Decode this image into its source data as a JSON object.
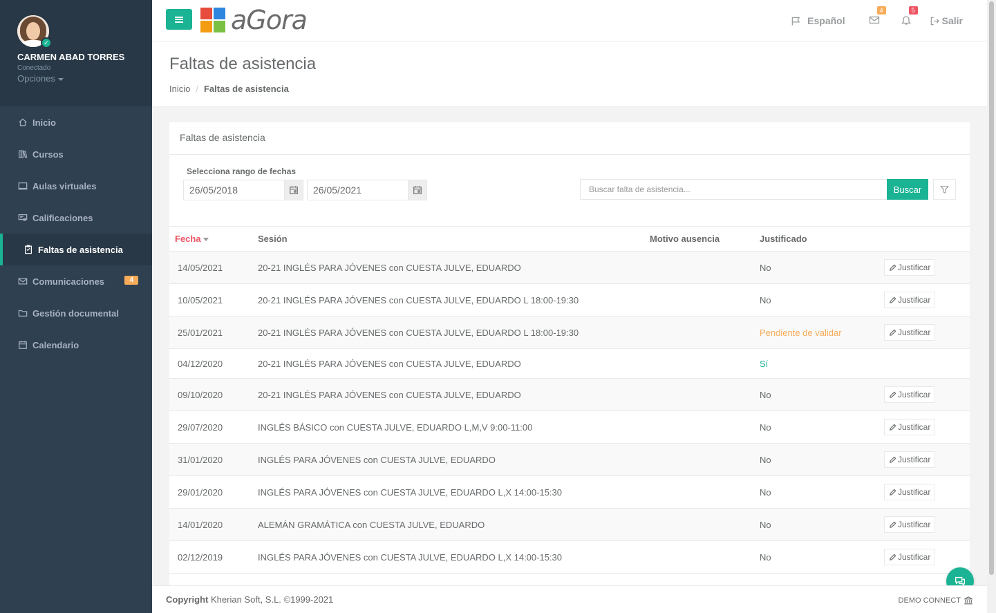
{
  "user": {
    "name": "CARMEN ABAD TORRES",
    "status": "Conectado",
    "options_label": "Opciones"
  },
  "sidebar": {
    "items": [
      {
        "label": "Inicio",
        "icon": "home-icon"
      },
      {
        "label": "Cursos",
        "icon": "books-icon"
      },
      {
        "label": "Aulas virtuales",
        "icon": "monitor-icon"
      },
      {
        "label": "Calificaciones",
        "icon": "certificate-icon"
      },
      {
        "label": "Faltas de asistencia",
        "icon": "clipboard-icon",
        "active": true
      },
      {
        "label": "Comunicaciones",
        "icon": "envelope-icon",
        "badge": "4"
      },
      {
        "label": "Gestión documental",
        "icon": "folder-icon"
      },
      {
        "label": "Calendario",
        "icon": "calendar-icon"
      }
    ]
  },
  "topbar": {
    "logo_text": "aGora",
    "language": "Español",
    "mail_badge": "4",
    "notif_badge": "5",
    "logout": "Salir"
  },
  "page": {
    "title": "Faltas de asistencia",
    "breadcrumb_home": "Inicio",
    "breadcrumb_current": "Faltas de asistencia"
  },
  "panel": {
    "title": "Faltas de asistencia",
    "range_label": "Selecciona rango de fechas",
    "date_from": "26/05/2018",
    "date_to": "26/05/2021",
    "search_placeholder": "Buscar falta de asistencia...",
    "search_button": "Buscar"
  },
  "table": {
    "headers": {
      "fecha": "Fecha",
      "sesion": "Sesión",
      "motivo": "Motivo ausencia",
      "justificado": "Justificado"
    },
    "action_label": "Justificar",
    "rows": [
      {
        "fecha": "14/05/2021",
        "sesion": "20-21 INGLÉS PARA JÓVENES con CUESTA JULVE, EDUARDO",
        "motivo": "",
        "justificado": "No",
        "status": "no",
        "action": true
      },
      {
        "fecha": "10/05/2021",
        "sesion": "20-21 INGLÉS PARA JÓVENES con CUESTA JULVE, EDUARDO L 18:00-19:30",
        "motivo": "",
        "justificado": "No",
        "status": "no",
        "action": true
      },
      {
        "fecha": "25/01/2021",
        "sesion": "20-21 INGLÉS PARA JÓVENES con CUESTA JULVE, EDUARDO L 18:00-19:30",
        "motivo": "",
        "justificado": "Pendiente de validar",
        "status": "pending",
        "action": true
      },
      {
        "fecha": "04/12/2020",
        "sesion": "20-21 INGLÉS PARA JÓVENES con CUESTA JULVE, EDUARDO",
        "motivo": "",
        "justificado": "Sí",
        "status": "yes",
        "action": false
      },
      {
        "fecha": "09/10/2020",
        "sesion": "20-21 INGLÉS PARA JÓVENES con CUESTA JULVE, EDUARDO",
        "motivo": "",
        "justificado": "No",
        "status": "no",
        "action": true
      },
      {
        "fecha": "29/07/2020",
        "sesion": "INGLÉS BÁSICO con CUESTA JULVE, EDUARDO L,M,V 9:00-11:00",
        "motivo": "",
        "justificado": "No",
        "status": "no",
        "action": true
      },
      {
        "fecha": "31/01/2020",
        "sesion": "INGLÉS PARA JÓVENES con CUESTA JULVE, EDUARDO",
        "motivo": "",
        "justificado": "No",
        "status": "no",
        "action": true
      },
      {
        "fecha": "29/01/2020",
        "sesion": "INGLÉS PARA JÓVENES con CUESTA JULVE, EDUARDO L,X 14:00-15:30",
        "motivo": "",
        "justificado": "No",
        "status": "no",
        "action": true
      },
      {
        "fecha": "14/01/2020",
        "sesion": "ALEMÁN GRAMÁTICA con CUESTA JULVE, EDUARDO",
        "motivo": "",
        "justificado": "No",
        "status": "no",
        "action": true
      },
      {
        "fecha": "02/12/2019",
        "sesion": "INGLÉS PARA JÓVENES con CUESTA JULVE, EDUARDO L,X 14:00-15:30",
        "motivo": "",
        "justificado": "No",
        "status": "no",
        "action": true
      }
    ]
  },
  "footer": {
    "copyright_bold": "Copyright",
    "copyright_text": "Kherian Soft, S.L. ©1999-2021",
    "right_text": "DEMO CONNECT"
  },
  "colors": {
    "primary": "#1ab394",
    "sidebar": "#2f4050",
    "warning": "#f8ac59",
    "danger": "#ed5565"
  }
}
